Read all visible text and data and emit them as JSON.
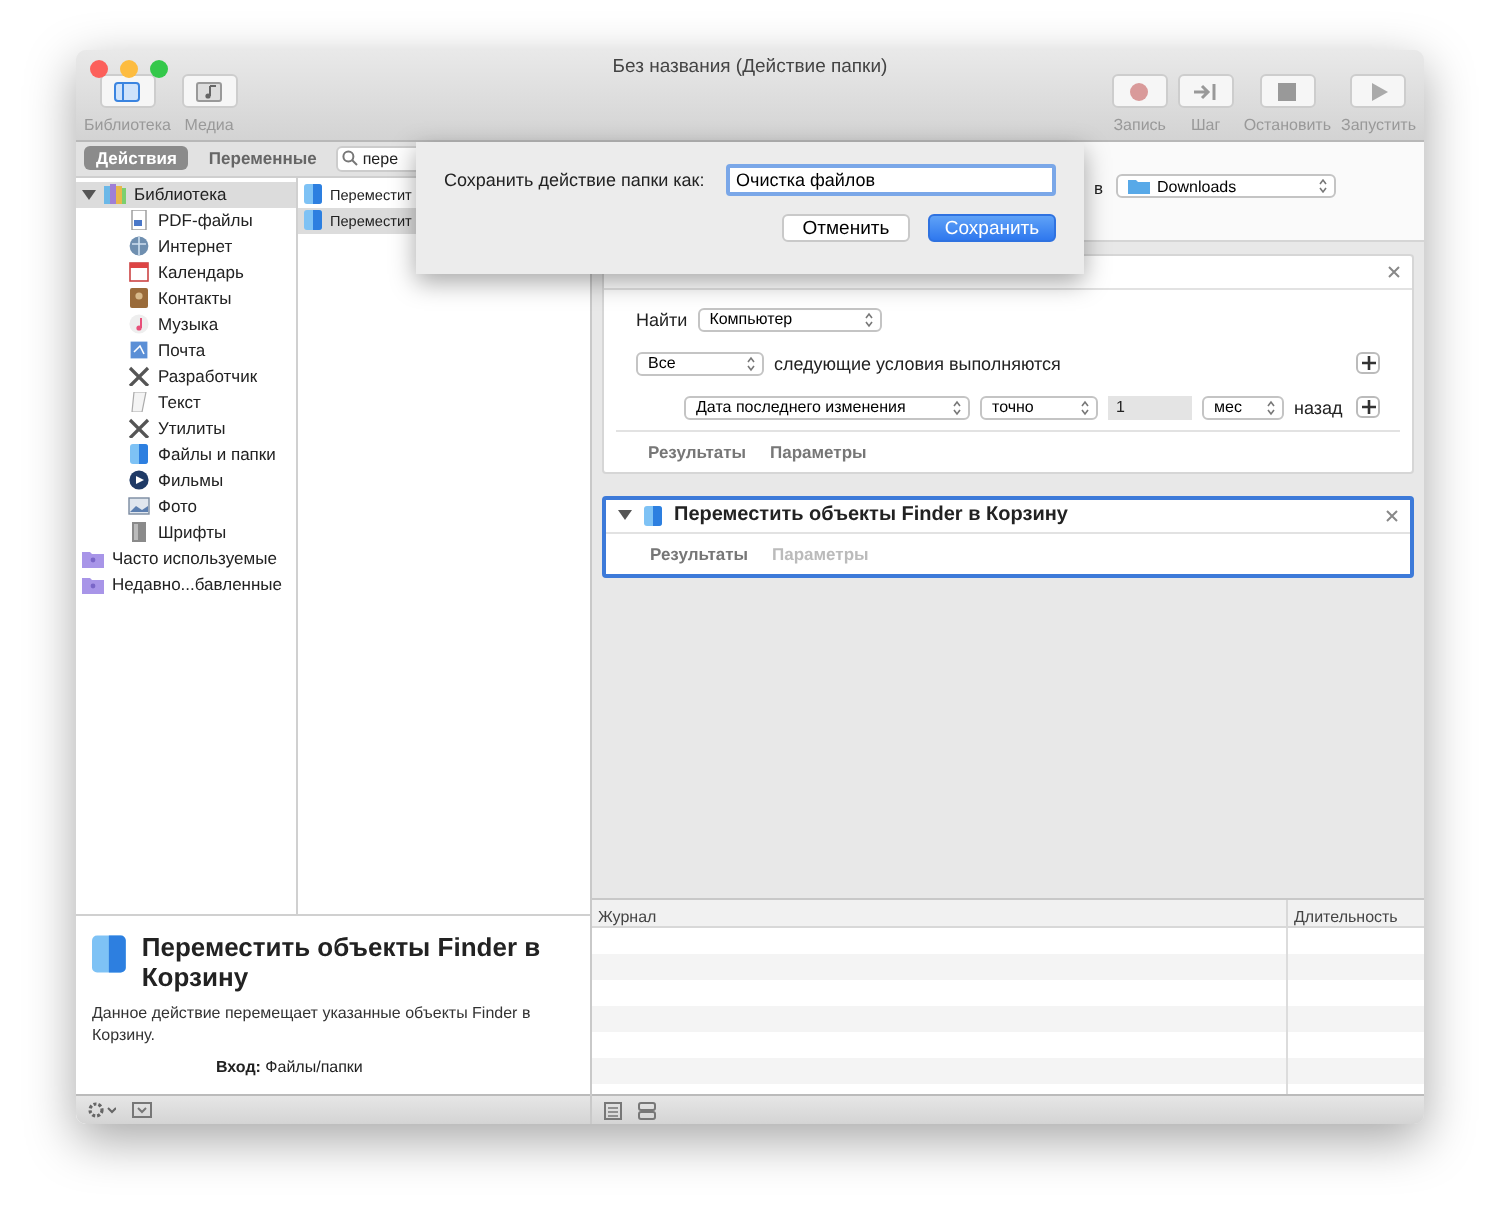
{
  "window": {
    "title": "Без названия (Действие папки)"
  },
  "toolbar_left": [
    {
      "label": "Библиотека",
      "kind": "library"
    },
    {
      "label": "Медиа",
      "kind": "media"
    }
  ],
  "toolbar_right": [
    {
      "label": "Запись",
      "kind": "record"
    },
    {
      "label": "Шаг",
      "kind": "step"
    },
    {
      "label": "Остановить",
      "kind": "stop"
    },
    {
      "label": "Запустить",
      "kind": "run"
    }
  ],
  "pane_tabs": [
    {
      "label": "Действия",
      "selected": true
    },
    {
      "label": "Переменные",
      "selected": false
    }
  ],
  "search": {
    "value": "пере"
  },
  "library": [
    {
      "label": "Библиотека",
      "kind": "library",
      "expanded": true,
      "selected": true,
      "children": [
        {
          "label": "PDF-файлы",
          "kind": "pdf",
          "selected": false
        },
        {
          "label": "Интернет",
          "kind": "globe",
          "selected": false
        },
        {
          "label": "Календарь",
          "kind": "calendar",
          "selected": false
        },
        {
          "label": "Контакты",
          "kind": "contacts",
          "selected": false
        },
        {
          "label": "Музыка",
          "kind": "music",
          "selected": false
        },
        {
          "label": "Почта",
          "kind": "mail",
          "selected": false
        },
        {
          "label": "Разработчик",
          "kind": "tools",
          "selected": false
        },
        {
          "label": "Текст",
          "kind": "text",
          "selected": false
        },
        {
          "label": "Утилиты",
          "kind": "tools",
          "selected": false
        },
        {
          "label": "Файлы и папки",
          "kind": "finder",
          "selected": false
        },
        {
          "label": "Фильмы",
          "kind": "movie",
          "selected": false
        },
        {
          "label": "Фото",
          "kind": "photo",
          "selected": false
        },
        {
          "label": "Шрифты",
          "kind": "fonts",
          "selected": false
        }
      ]
    },
    {
      "label": "Часто используемые",
      "kind": "smart",
      "selected": false
    },
    {
      "label": "Недавно...бавленные",
      "kind": "smart",
      "selected": false
    }
  ],
  "actions": [
    {
      "label": "Переместит",
      "selected": false
    },
    {
      "label": "Переместит",
      "selected": true
    }
  ],
  "description": {
    "title": "Переместить объекты Finder в Корзину",
    "text": "Данное действие перемещает указанные объекты Finder в Корзину.",
    "input": "**Вход:** Файлы/папки"
  },
  "workflow": {
    "header_tail": "в",
    "folder": "Downloads",
    "steps": [
      {
        "kind": "find",
        "selected": false,
        "find_label": "Найти",
        "scope": "Компьютер",
        "match": "Все",
        "match_text": "следующие условия выполняются",
        "condition": {
          "attribute": "Дата последнего изменения",
          "operator": "точно",
          "value": "1",
          "unit": "мес",
          "suffix": "назад"
        },
        "tabs": [
          {
            "label": "Результаты",
            "disabled": false
          },
          {
            "label": "Параметры",
            "disabled": false
          }
        ]
      },
      {
        "kind": "move",
        "selected": true,
        "expanded": true,
        "title": "Переместить объекты Finder в Корзину",
        "tabs": [
          {
            "label": "Результаты",
            "disabled": false
          },
          {
            "label": "Параметры",
            "disabled": true
          }
        ]
      }
    ]
  },
  "log": {
    "columns": [
      "Журнал",
      "Длительность"
    ]
  },
  "dialog": {
    "label": "Сохранить действие папки как:",
    "value": "Очистка файлов",
    "buttons": [
      {
        "label": "Отменить",
        "primary": false
      },
      {
        "label": "Сохранить",
        "primary": true
      }
    ]
  }
}
